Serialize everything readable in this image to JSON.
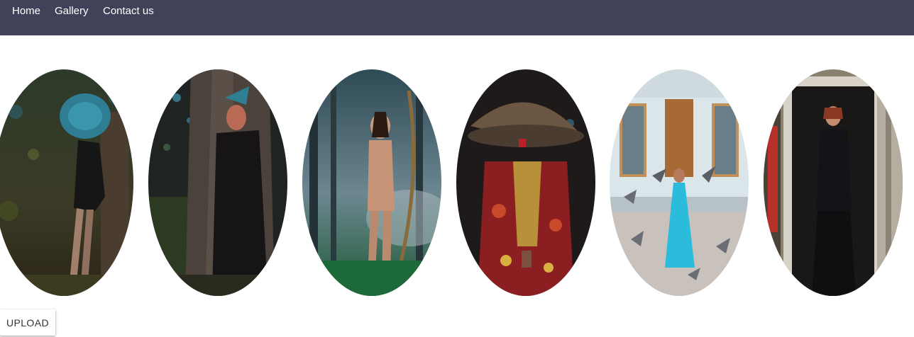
{
  "navbar": {
    "color": "#41425a",
    "links": [
      {
        "label": "Home"
      },
      {
        "label": "Gallery"
      },
      {
        "label": "Contact us"
      }
    ]
  },
  "gallery": {
    "items": [
      {
        "subject": "woman in dark forest with blue headdress"
      },
      {
        "subject": "woman beside tree trunk in dark dress"
      },
      {
        "subject": "woman with bow in misty forest"
      },
      {
        "subject": "figure in wide straw hat and red embroidered robe"
      },
      {
        "subject": "woman in blue dress with pigeons before building"
      },
      {
        "subject": "woman in black outfit standing in doorway"
      }
    ]
  },
  "upload_button": {
    "label": "UPLOAD"
  }
}
